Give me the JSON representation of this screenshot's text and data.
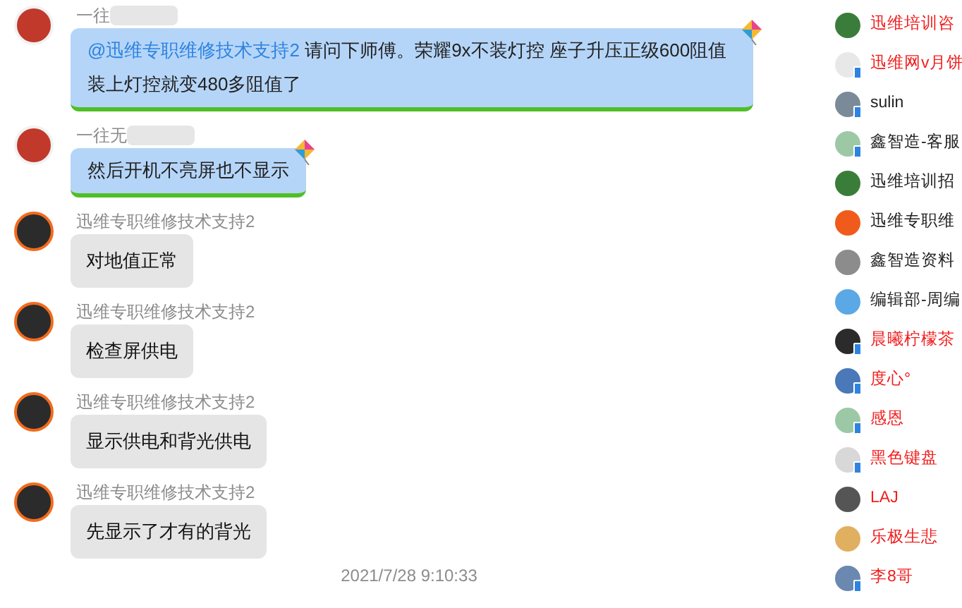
{
  "messages": [
    {
      "sender": "一往",
      "sender_hidden": true,
      "kind": "themed",
      "mention": "@迅维专职维修技术支持2",
      "text": "请问下师傅。荣耀9x不装灯控 座子升压正级600阻值装上灯控就变480多阻值了"
    },
    {
      "sender": "一往无",
      "sender_hidden": true,
      "kind": "themed",
      "text": "然后开机不亮屏也不显示"
    },
    {
      "sender": "迅维专职维修技术支持2",
      "sender_hidden": false,
      "kind": "plain",
      "text": "对地值正常"
    },
    {
      "sender": "迅维专职维修技术支持2",
      "sender_hidden": false,
      "kind": "plain",
      "text": "检查屏供电"
    },
    {
      "sender": "迅维专职维修技术支持2",
      "sender_hidden": false,
      "kind": "plain",
      "text": "显示供电和背光供电"
    },
    {
      "sender": "迅维专职维修技术支持2",
      "sender_hidden": false,
      "kind": "plain",
      "text": "先显示了才有的背光"
    }
  ],
  "timestamp": "2021/7/28 9:10:33",
  "members": [
    {
      "name": "迅维培训咨",
      "vip": true,
      "mobile": false,
      "color": "#3a7d3a"
    },
    {
      "name": "迅维网v月饼",
      "vip": true,
      "mobile": true,
      "color": "#e8e8e8"
    },
    {
      "name": "sulin",
      "vip": false,
      "mobile": true,
      "color": "#7a8a99"
    },
    {
      "name": "鑫智造-客服",
      "vip": false,
      "mobile": true,
      "color": "#9cc8a6"
    },
    {
      "name": "迅维培训招",
      "vip": false,
      "mobile": false,
      "color": "#3a7d3a"
    },
    {
      "name": "迅维专职维",
      "vip": false,
      "mobile": false,
      "color": "#f05a1a"
    },
    {
      "name": "鑫智造资料",
      "vip": false,
      "mobile": false,
      "color": "#8c8c8c"
    },
    {
      "name": "编辑部-周编",
      "vip": false,
      "mobile": false,
      "color": "#5aa8e6"
    },
    {
      "name": "晨曦柠檬茶",
      "vip": true,
      "mobile": true,
      "color": "#2b2b2b"
    },
    {
      "name": "度心°",
      "vip": true,
      "mobile": true,
      "color": "#4a78b8"
    },
    {
      "name": "感恩",
      "vip": true,
      "mobile": true,
      "color": "#9cc8a6"
    },
    {
      "name": "黑色键盘",
      "vip": true,
      "mobile": true,
      "color": "#d8d8d8"
    },
    {
      "name": "LAJ",
      "vip": true,
      "mobile": false,
      "color": "#555555"
    },
    {
      "name": "乐极生悲",
      "vip": true,
      "mobile": false,
      "color": "#e0b060"
    },
    {
      "name": "李8哥",
      "vip": true,
      "mobile": true,
      "color": "#6a88b0"
    }
  ]
}
